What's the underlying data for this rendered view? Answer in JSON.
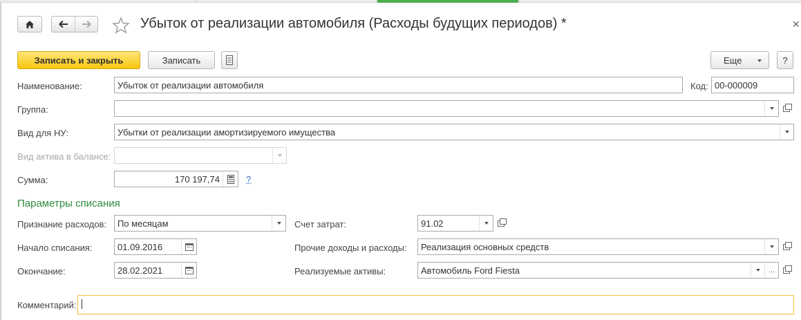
{
  "window": {
    "title": "Убыток от реализации автомобиля (Расходы будущих периодов) *"
  },
  "toolbar": {
    "save_close_label": "Записать и закрыть",
    "save_label": "Записать",
    "more_label": "Еще",
    "help_label": "?"
  },
  "form": {
    "name": {
      "label": "Наименование:",
      "value": "Убыток от реализации автомобиля"
    },
    "code": {
      "label": "Код:",
      "value": "00-000009"
    },
    "group": {
      "label": "Группа:",
      "value": ""
    },
    "tax_type": {
      "label": "Вид для НУ:",
      "value": "Убытки от реализации амортизируемого имущества"
    },
    "asset_type": {
      "label": "Вид актива в балансе:",
      "value": ""
    },
    "amount": {
      "label": "Сумма:",
      "value": "170 197,74",
      "help": "?"
    }
  },
  "writeoff": {
    "section_title": "Параметры списания",
    "recognition": {
      "label": "Признание расходов:",
      "value": "По месяцам"
    },
    "start": {
      "label": "Начало списания:",
      "value": "01.09.2016"
    },
    "end": {
      "label": "Окончание:",
      "value": "28.02.2021"
    },
    "cost_account": {
      "label": "Счет затрат:",
      "value": "91.02"
    },
    "other_income": {
      "label": "Прочие доходы и расходы:",
      "value": "Реализация основных средств"
    },
    "assets": {
      "label": "Реализуемые активы:",
      "value": "Автомобиль Ford Fiesta",
      "ellipsis": "..."
    }
  },
  "comment": {
    "label": "Комментарий:",
    "value": ""
  },
  "colors": {
    "primary_button": "#f8c70c",
    "section_title": "#2e8b3d",
    "active_tab": "#4caf50",
    "comment_border": "#f0c040"
  }
}
